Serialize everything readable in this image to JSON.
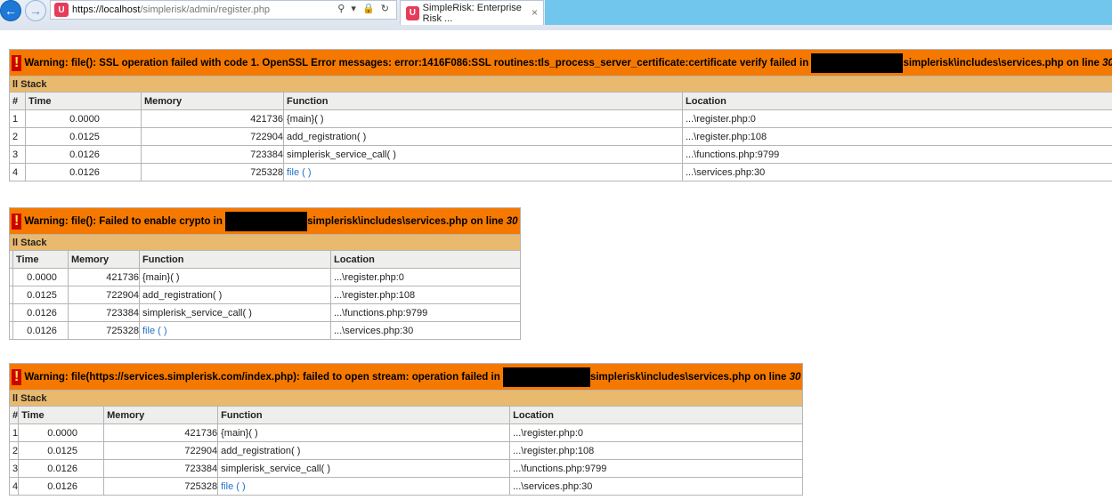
{
  "browser": {
    "url_host": "https://localhost",
    "url_path": "/simplerisk/admin/register.php",
    "tab_title": "SimpleRisk: Enterprise Risk ...",
    "tab_close": "×"
  },
  "blocks": [
    {
      "bang": "!",
      "warning_prefix": "Warning: file(): SSL operation failed with code 1. OpenSSL Error messages: error:1416F086:SSL routines:tls_process_server_certificate:certificate verify failed in ",
      "warning_suffix": "simplerisk\\includes\\services.php on line ",
      "line": "30",
      "callstack_label": "ll Stack",
      "headers": [
        "#",
        "Time",
        "Memory",
        "Function",
        "Location"
      ],
      "rows": [
        {
          "num": "1",
          "time": "0.0000",
          "memory": "421736",
          "function": "{main}( )",
          "location": "...\\register.php:0",
          "link": false
        },
        {
          "num": "2",
          "time": "0.0125",
          "memory": "722904",
          "function": "add_registration( )",
          "location": "...\\register.php:108",
          "link": false
        },
        {
          "num": "3",
          "time": "0.0126",
          "memory": "723384",
          "function": "simplerisk_service_call( )",
          "location": "...\\functions.php:9799",
          "link": false
        },
        {
          "num": "4",
          "time": "0.0126",
          "memory": "725328",
          "function": "file ( )",
          "location": "...\\services.php:30",
          "link": true
        }
      ]
    },
    {
      "bang": "!",
      "warning_prefix": "Warning: file(): Failed to enable crypto in ",
      "warning_suffix": "simplerisk\\includes\\services.php on line ",
      "line": "30",
      "callstack_label": "ll Stack",
      "headers": [
        "",
        "Time",
        "Memory",
        "Function",
        "Location"
      ],
      "rows": [
        {
          "num": "",
          "time": "0.0000",
          "memory": "421736",
          "function": "{main}( )",
          "location": "...\\register.php:0",
          "link": false
        },
        {
          "num": "",
          "time": "0.0125",
          "memory": "722904",
          "function": "add_registration( )",
          "location": "...\\register.php:108",
          "link": false
        },
        {
          "num": "",
          "time": "0.0126",
          "memory": "723384",
          "function": "simplerisk_service_call( )",
          "location": "...\\functions.php:9799",
          "link": false
        },
        {
          "num": "",
          "time": "0.0126",
          "memory": "725328",
          "function": "file ( )",
          "location": "...\\services.php:30",
          "link": true
        }
      ]
    },
    {
      "bang": "!",
      "warning_prefix": "Warning: file(https://services.simplerisk.com/index.php): failed to open stream: operation failed in ",
      "warning_suffix": "simplerisk\\includes\\services.php on line ",
      "line": "30",
      "callstack_label": "ll Stack",
      "headers": [
        "#",
        "Time",
        "Memory",
        "Function",
        "Location"
      ],
      "rows": [
        {
          "num": "1",
          "time": "0.0000",
          "memory": "421736",
          "function": "{main}( )",
          "location": "...\\register.php:0",
          "link": false
        },
        {
          "num": "2",
          "time": "0.0125",
          "memory": "722904",
          "function": "add_registration( )",
          "location": "...\\register.php:108",
          "link": false
        },
        {
          "num": "3",
          "time": "0.0126",
          "memory": "723384",
          "function": "simplerisk_service_call( )",
          "location": "...\\functions.php:9799",
          "link": false
        },
        {
          "num": "4",
          "time": "0.0126",
          "memory": "725328",
          "function": "file ( )",
          "location": "...\\services.php:30",
          "link": true
        }
      ]
    }
  ]
}
